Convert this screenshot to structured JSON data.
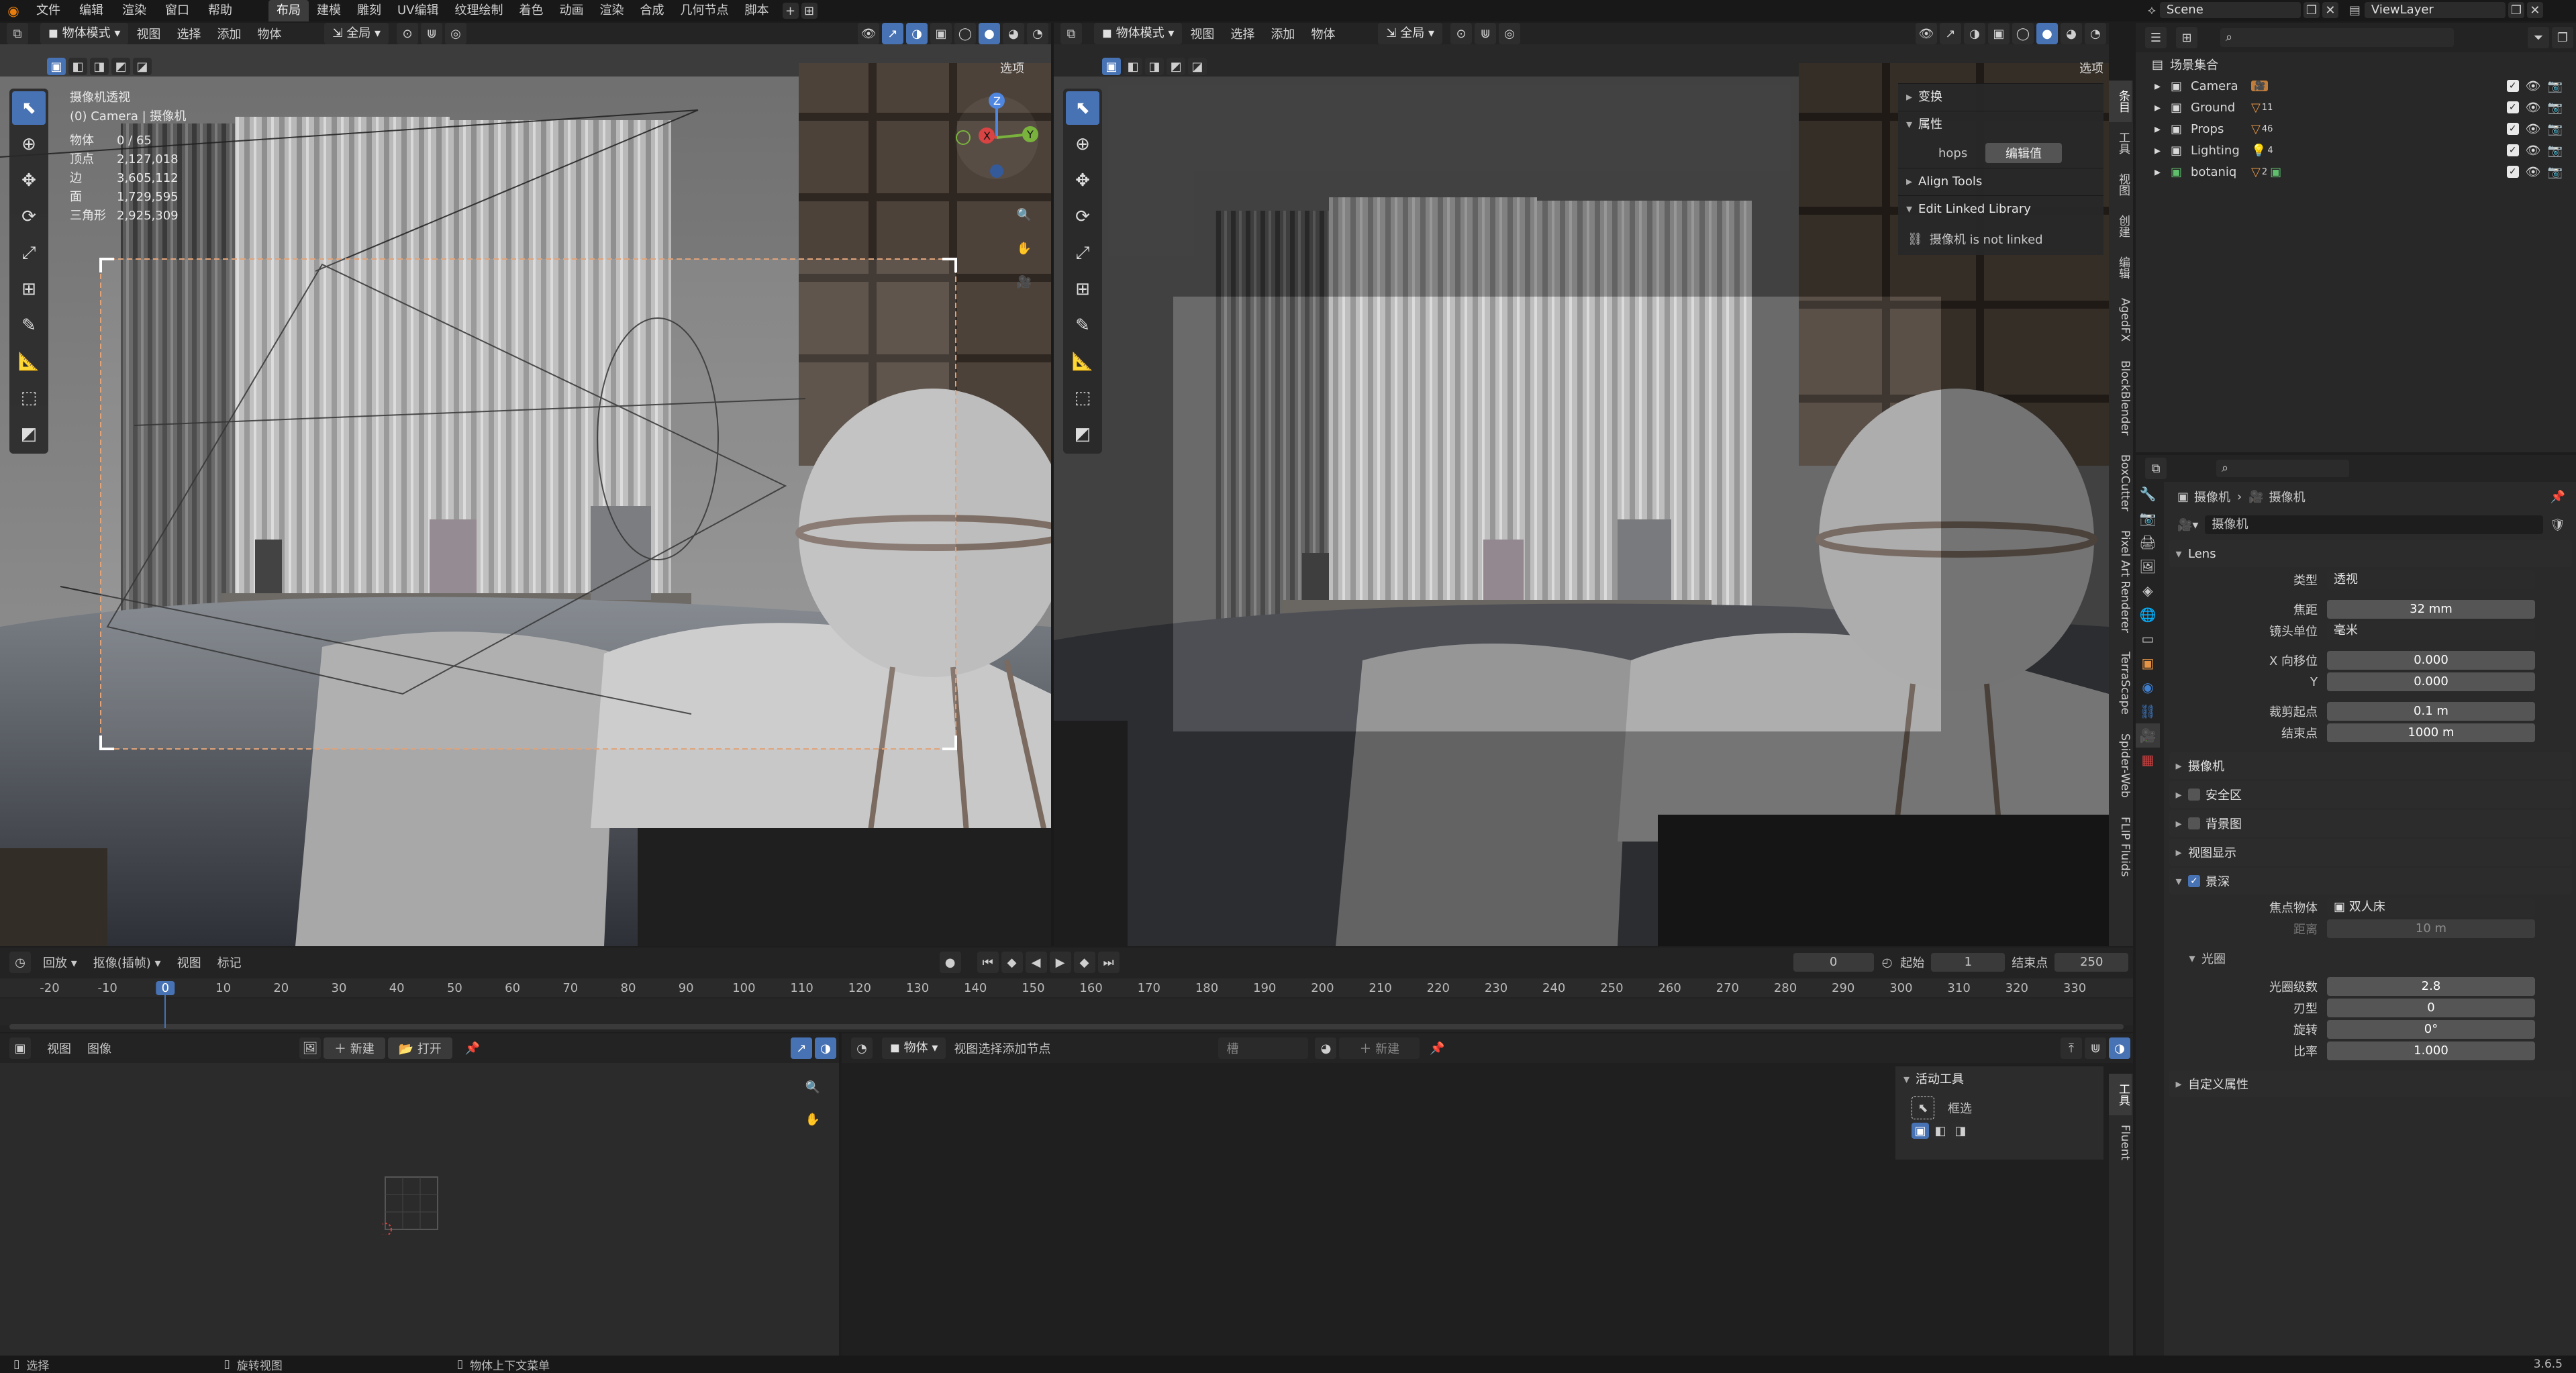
{
  "menu": {
    "items": [
      "文件",
      "编辑",
      "渲染",
      "窗口",
      "帮助"
    ],
    "workspaces": [
      "布局",
      "建模",
      "雕刻",
      "UV编辑",
      "纹理绘制",
      "着色",
      "动画",
      "渲染",
      "合成",
      "几何节点",
      "脚本"
    ],
    "active_workspace": "布局",
    "scene": "Scene",
    "view_layer": "ViewLayer"
  },
  "left_viewport": {
    "mode": "物体模式",
    "menus": [
      "视图",
      "选择",
      "添加",
      "物体"
    ],
    "transform": "全局",
    "options": "选项",
    "overlay_title": "摄像机透视",
    "overlay_subtitle": "(0) Camera | 摄像机",
    "stats": [
      {
        "label": "物体",
        "value": "0 / 65"
      },
      {
        "label": "顶点",
        "value": "2,127,018"
      },
      {
        "label": "边",
        "value": "3,605,112"
      },
      {
        "label": "面",
        "value": "1,729,595"
      },
      {
        "label": "三角形",
        "value": "2,925,309"
      }
    ]
  },
  "right_viewport": {
    "mode": "物体模式",
    "menus": [
      "视图",
      "选择",
      "添加",
      "物体"
    ],
    "transform": "全局",
    "options": "选项",
    "npanel": {
      "transform": "变换",
      "properties": "属性",
      "hops_label": "hops",
      "hops_button": "编辑值",
      "align_tools": "Align Tools",
      "edit_linked": "Edit Linked Library",
      "not_linked": "摄像机 is not linked"
    },
    "tabs": [
      "条目",
      "工具",
      "视图",
      "创建",
      "编辑",
      "AgedFX",
      "BlockBlender",
      "BoxCutter",
      "Pixel Art Renderer",
      "TerraScape",
      "Spider-Web",
      "FLIP Fluids"
    ]
  },
  "timeline": {
    "menus": [
      "回放",
      "抠像(插帧)",
      "视图",
      "标记"
    ],
    "current_frame": "0",
    "start_label": "起始",
    "start": "1",
    "end_label": "结束点",
    "end": "250",
    "ticks": [
      "-20",
      "-10",
      "0",
      "10",
      "20",
      "30",
      "40",
      "50",
      "60",
      "70",
      "80",
      "90",
      "100",
      "110",
      "120",
      "130",
      "140",
      "150",
      "160",
      "170",
      "180",
      "190",
      "200",
      "210",
      "220",
      "230",
      "240",
      "250",
      "260",
      "270",
      "280",
      "290",
      "300",
      "310",
      "320",
      "330"
    ]
  },
  "image_editor": {
    "menus": [
      "视图",
      "图像"
    ],
    "new": "新建",
    "open": "打开"
  },
  "node_editor": {
    "type": "物体",
    "menus": [
      "视图",
      "选择",
      "添加",
      "节点"
    ],
    "slot": "槽",
    "new": "新建",
    "active_tool_title": "活动工具",
    "active_tool": "框选",
    "tabs": [
      "工具",
      "Fluent"
    ]
  },
  "outliner": {
    "root": "场景集合",
    "items": [
      {
        "name": "Camera",
        "badge": ""
      },
      {
        "name": "Ground",
        "badge": "11"
      },
      {
        "name": "Props",
        "badge": "46"
      },
      {
        "name": "Lighting",
        "badge": "4"
      },
      {
        "name": "botaniq",
        "badge": "2"
      }
    ]
  },
  "properties": {
    "breadcrumb": [
      "摄像机",
      "摄像机"
    ],
    "datablock": "摄像机",
    "lens_panel": "Lens",
    "type_label": "类型",
    "type_value": "透视",
    "focal_label": "焦距",
    "focal_value": "32 mm",
    "unit_label": "镜头单位",
    "unit_value": "毫米",
    "shift_x_label": "X 向移位",
    "shift_x": "0.000",
    "shift_y_label": "Y",
    "shift_y": "0.000",
    "clip_start_label": "裁剪起点",
    "clip_start": "0.1 m",
    "clip_end_label": "结束点",
    "clip_end": "1000 m",
    "panels_closed": [
      "摄像机",
      "安全区",
      "背景图",
      "视图显示"
    ],
    "dof_panel": "景深",
    "focus_obj_label": "焦点物体",
    "focus_obj": "双人床",
    "distance_label": "距离",
    "distance": "10 m",
    "aperture_panel": "光圈",
    "fstop_label": "光圈级数",
    "fstop": "2.8",
    "blades_label": "刃型",
    "blades": "0",
    "rotation_label": "旋转",
    "rotation": "0°",
    "ratio_label": "比率",
    "ratio": "1.000",
    "custom_props": "自定义属性"
  },
  "statusbar": {
    "select": "选择",
    "rotate": "旋转视图",
    "context": "物体上下文菜单",
    "version": "3.6.5"
  }
}
